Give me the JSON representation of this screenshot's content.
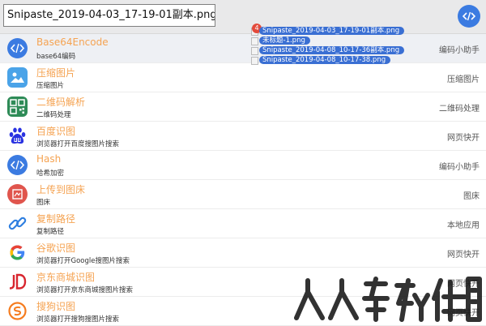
{
  "search": {
    "value": "Snipaste_2019-04-03_17-19-01副本.png"
  },
  "colors": {
    "accent": "#3b7be1",
    "title": "#f5a352",
    "badge": "#e34b3c",
    "drag_highlight": "#3a6fd3"
  },
  "header": {
    "action_icon": "code-icon"
  },
  "drag": {
    "count": "4",
    "files": [
      "Snipaste_2019-04-03_17-19-01副本.png",
      "未标题-1.png",
      "Snipaste_2019-04-08_10-17-36副本.png",
      "Snipaste_2019-04-08_10-17-38.png"
    ]
  },
  "items": [
    {
      "title": "Base64Encode",
      "subtitle": "base64编码",
      "category": "编码小助手",
      "icon": "code-icon"
    },
    {
      "title": "压缩图片",
      "subtitle": "压缩图片",
      "category": "压缩图片",
      "icon": "image-icon"
    },
    {
      "title": "二维码解析",
      "subtitle": "二维码处理",
      "category": "二维码处理",
      "icon": "qrcode-icon"
    },
    {
      "title": "百度识图",
      "subtitle": "浏览器打开百度搜图片搜索",
      "category": "网页快开",
      "icon": "baidu-icon"
    },
    {
      "title": "Hash",
      "subtitle": "哈希加密",
      "category": "编码小助手",
      "icon": "code-icon"
    },
    {
      "title": "上传到图床",
      "subtitle": "图床",
      "category": "图床",
      "icon": "upload-icon"
    },
    {
      "title": "复制路径",
      "subtitle": "复制路径",
      "category": "本地应用",
      "icon": "link-icon"
    },
    {
      "title": "谷歌识图",
      "subtitle": "浏览器打开Google搜图片搜索",
      "category": "网页快开",
      "icon": "google-icon"
    },
    {
      "title": "京东商城识图",
      "subtitle": "浏览器打开京东商城搜图片搜索",
      "category": "网页快开",
      "icon": "jd-icon"
    },
    {
      "title": "搜狗识图",
      "subtitle": "浏览器打开搜狗搜图片搜索",
      "category": "网页快开",
      "icon": "sogou-icon"
    }
  ]
}
